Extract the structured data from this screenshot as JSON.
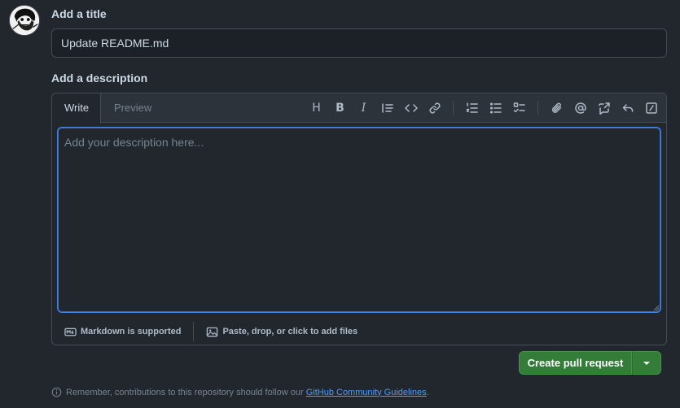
{
  "form": {
    "title_label": "Add a title",
    "title_value": "Update README.md",
    "description_label": "Add a description"
  },
  "editor": {
    "tabs": {
      "write": "Write",
      "preview": "Preview"
    },
    "toolbar": {
      "heading": "H",
      "bold": "B",
      "italic": "I"
    },
    "placeholder": "Add your description here...",
    "markdown_note": "Markdown is supported",
    "attach_note": "Paste, drop, or click to add files"
  },
  "actions": {
    "create_label": "Create pull request"
  },
  "footer": {
    "note_prefix": "Remember, contributions to this repository should follow our",
    "link_text": "GitHub Community Guidelines",
    "note_suffix": "."
  },
  "colors": {
    "background": "#22272e",
    "border": "#444c56",
    "accent_blue": "#539bf5",
    "button_green": "#347d39"
  },
  "icons": [
    "avatar",
    "heading-icon",
    "bold-icon",
    "italic-icon",
    "quote-icon",
    "code-icon",
    "link-icon",
    "ordered-list-icon",
    "unordered-list-icon",
    "task-list-icon",
    "paperclip-icon",
    "mention-icon",
    "cross-reference-icon",
    "reply-icon",
    "slash-command-icon",
    "markdown-icon",
    "image-icon",
    "info-icon",
    "chevron-down-icon"
  ]
}
